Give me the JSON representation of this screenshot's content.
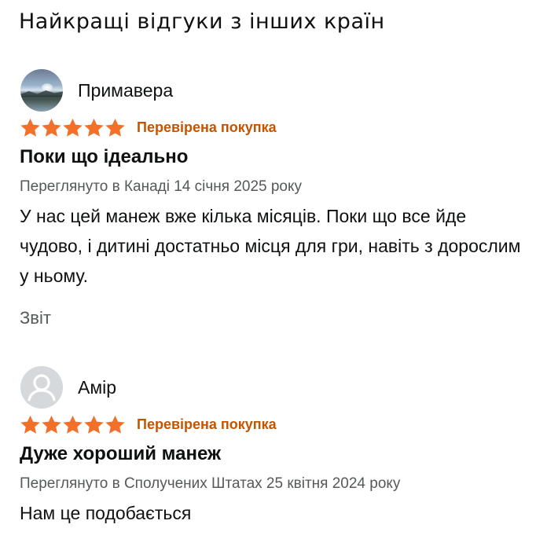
{
  "section": {
    "title": "Найкращі відгуки з інших країн"
  },
  "colors": {
    "star": "#f3702b",
    "verified": "#c45500",
    "meta": "#565959",
    "text": "#0f1111"
  },
  "reviews": [
    {
      "avatar": "landscape-photo",
      "name": "Примавера",
      "rating": 5,
      "rating_max": 5,
      "verified": "Перевірена покупка",
      "title": "Поки що ідеально",
      "meta": "Переглянуто в Канаді 14 січня 2025 року",
      "body": "У нас цей манеж вже кілька місяців. Поки що все йде чудово, і дитині достатньо місця для гри, навіть з дорослим у ньому.",
      "report": "Звіт"
    },
    {
      "avatar": "default-user-icon",
      "name": "Амір",
      "rating": 5,
      "rating_max": 5,
      "verified": "Перевірена покупка",
      "title": "Дуже хороший манеж",
      "meta": "Переглянуто в Сполучених Штатах 25 квітня 2024 року",
      "body": "Нам це подобається"
    }
  ]
}
